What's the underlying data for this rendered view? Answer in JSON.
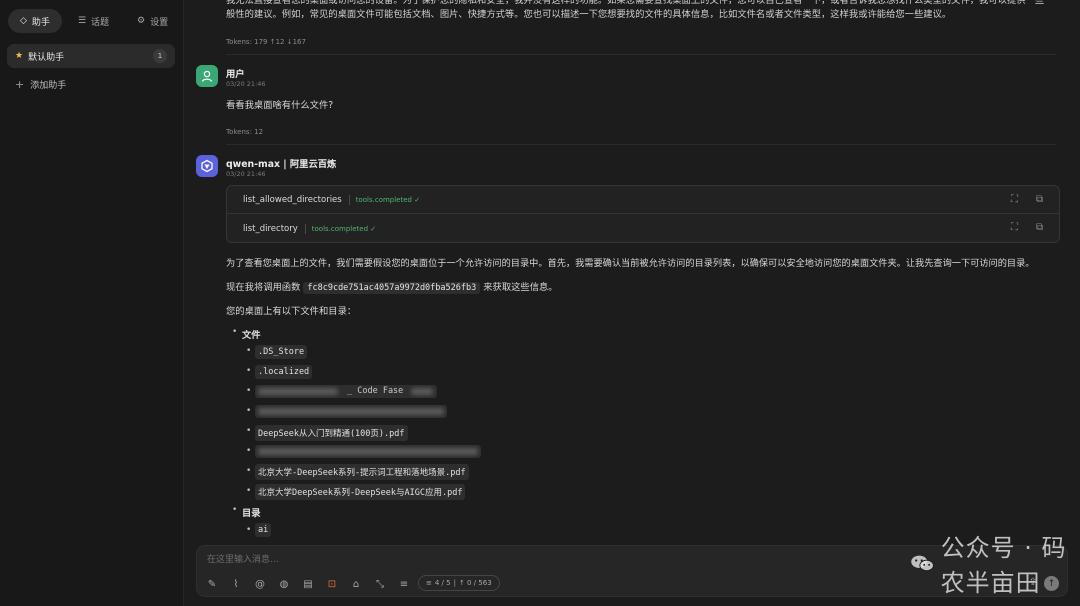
{
  "sidebar": {
    "tabs": [
      {
        "icon": "◇",
        "label": "助手"
      },
      {
        "icon": "☰",
        "label": "话题"
      },
      {
        "icon": "⚙",
        "label": "设置"
      }
    ],
    "assistant": {
      "label": "默认助手",
      "count": "1"
    },
    "add_label": "添加助手"
  },
  "chat": {
    "prev_text": "我无法直接查看您的桌面或访问您的设备。为了保护您的隐私和安全，我并没有这样的功能。如果您需要查找桌面上的文件，您可以自己查看一下，或者告诉我您想找什么类型的文件，我可以提供一些一般性的建议。例如，常见的桌面文件可能包括文档、图片、快捷方式等。您也可以描述一下您想要找的文件的具体信息，比如文件名或者文件类型，这样我或许能给您一些建议。",
    "prev_tokens": "Tokens: 179 ↑12 ↓167",
    "user": {
      "name": "用户",
      "time": "03/20 21:46",
      "text": "看看我桌面啥有什么文件?",
      "tokens": "Tokens: 12"
    },
    "bot": {
      "name": "qwen-max | 阿里云百炼",
      "time": "03/20 21:46",
      "tools": [
        {
          "name": "list_allowed_directories",
          "status": "tools.completed ✓"
        },
        {
          "name": "list_directory",
          "status": "tools.completed ✓"
        }
      ],
      "p1": "为了查看您桌面上的文件，我们需要假设您的桌面位于一个允许访问的目录中。首先，我需要确认当前被允许访问的目录列表，以确保可以安全地访问您的桌面文件夹。让我先查询一下可访问的目录。",
      "p2_before": "现在我将调用函数",
      "p2_code": "fc8c9cde751ac4057a9972d0fba526fb3",
      "p2_after": "来获取这些信息。",
      "p3": "您的桌面上有以下文件和目录：",
      "files_label": "文件",
      "files": [
        ".DS_Store",
        ".localized",
        "DeepSeek从入门到精通(100页).pdf",
        "北京大学-DeepSeek系列-提示词工程和落地场景.pdf",
        "北京大学DeepSeek系列-DeepSeek与AIGC应用.pdf"
      ],
      "blurred_partial": "_ Code Fase",
      "dirs_label": "目录",
      "dirs": [
        "ai"
      ]
    }
  },
  "input": {
    "placeholder": "在这里输入消息...",
    "counter": "4 / 5",
    "counter_tokens": "↑ 0 / 563"
  },
  "watermark": {
    "text": "公众号 · 码农半亩田"
  }
}
